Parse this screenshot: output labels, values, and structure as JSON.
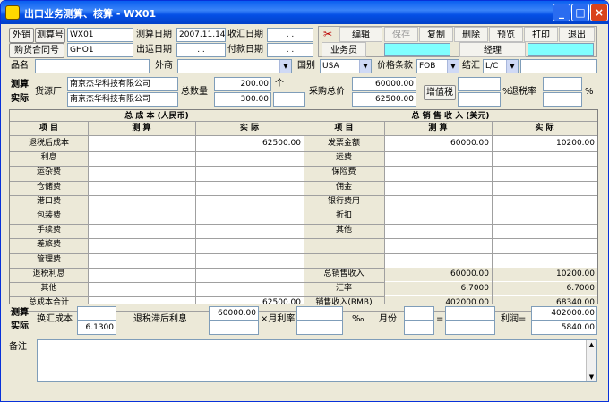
{
  "window": {
    "title": "出口业务测算、核算 - WX01",
    "min": "_",
    "max": "□",
    "close": "×"
  },
  "row1": {
    "btn_waixiao": "外销",
    "btn_cesuanhao": "测算号",
    "cesuanhao_value": "WX01",
    "cesuan_date_label": "测算日期",
    "cesuan_date_value": "2007.11.14",
    "shouhui_label": "收汇日期",
    "shouhui_value": ". .",
    "gouhuo_btn": "购货合同号",
    "gouhuo_value": "GHO1",
    "chuyun_label": "出运日期",
    "chuyun_value": ". .",
    "fukuan_label": "付款日期",
    "fukuan_value": ". ."
  },
  "toolbar": {
    "edit": "编辑",
    "save": "保存",
    "copy": "复制",
    "delete": "删除",
    "preview": "预览",
    "print": "打印",
    "exit": "退出",
    "salesman": "业务员",
    "manager": "经理"
  },
  "row3": {
    "pinming": "品名",
    "waishang": "外商",
    "guobie": "国别",
    "guobie_value": "USA",
    "jiage_label": "价格条款",
    "jiage_value": "FOB",
    "jiehui_label": "结汇",
    "jiehui_value": "L/C"
  },
  "row4": {
    "ce": "测算",
    "shi": "实际",
    "gonghuo_label": "货源厂",
    "supplier1": "南京杰华科技有限公司",
    "supplier2": "南京杰华科技有限公司",
    "qty_label": "总数量",
    "qty1": "200.00",
    "qty_unit": "个",
    "qty2": "300.00",
    "caigou_label": "采购总价",
    "caigou1": "60000.00",
    "caigou2": "62500.00",
    "vat_btn": "增值税",
    "pct": "%",
    "tuishui_label": "退税率",
    "pct2": "%"
  },
  "grid": {
    "cost_title": "总 成 本 (人民币)",
    "sales_title": "总 销 售 收 入 (美元)",
    "h_item": "项 目",
    "h_ce": "测 算",
    "h_shi": "实 际",
    "cost_rows": [
      {
        "name": "退税后成本",
        "ce": "",
        "shi": "62500.00"
      },
      {
        "name": "利息",
        "ce": "",
        "shi": ""
      },
      {
        "name": "运杂费",
        "ce": "",
        "shi": ""
      },
      {
        "name": "仓储费",
        "ce": "",
        "shi": ""
      },
      {
        "name": "港口费",
        "ce": "",
        "shi": ""
      },
      {
        "name": "包装费",
        "ce": "",
        "shi": ""
      },
      {
        "name": "手续费",
        "ce": "",
        "shi": ""
      },
      {
        "name": "差旅费",
        "ce": "",
        "shi": ""
      },
      {
        "name": "管理费",
        "ce": "",
        "shi": ""
      },
      {
        "name": "退税利息",
        "ce": "",
        "shi": ""
      },
      {
        "name": "其他",
        "ce": "",
        "shi": ""
      },
      {
        "name": "总成本合计",
        "ce": "",
        "shi": "62500.00"
      }
    ],
    "sales_rows": [
      {
        "name": "发票金额",
        "ce": "60000.00",
        "shi": "10200.00"
      },
      {
        "name": "运费",
        "ce": "",
        "shi": ""
      },
      {
        "name": "保险费",
        "ce": "",
        "shi": ""
      },
      {
        "name": "佣金",
        "ce": "",
        "shi": ""
      },
      {
        "name": "银行费用",
        "ce": "",
        "shi": ""
      },
      {
        "name": "折扣",
        "ce": "",
        "shi": ""
      },
      {
        "name": "其他",
        "ce": "",
        "shi": ""
      },
      {
        "name": "",
        "ce": "",
        "shi": ""
      },
      {
        "name": "",
        "ce": "",
        "shi": ""
      },
      {
        "name": "总销售收入",
        "ce": "60000.00",
        "shi": "10200.00"
      },
      {
        "name": "汇率",
        "ce": "6.7000",
        "shi": "6.7000"
      },
      {
        "name": "销售收入(RMB)",
        "ce": "402000.00",
        "shi": "68340.00"
      }
    ]
  },
  "bottom": {
    "ce": "测算",
    "shi": "实际",
    "huanhui": "换汇成本",
    "huanhui_shi": "6.1300",
    "tuishui_label": "退税滞后利息",
    "tuishui_val": "60000.00",
    "yuelilv": "×月利率",
    "permil": "‰",
    "yuefen": "月份",
    "eq": "=",
    "lirun": "利润=",
    "lirun1": "402000.00",
    "lirun2": "5840.00"
  },
  "notes": {
    "label": "备注"
  }
}
